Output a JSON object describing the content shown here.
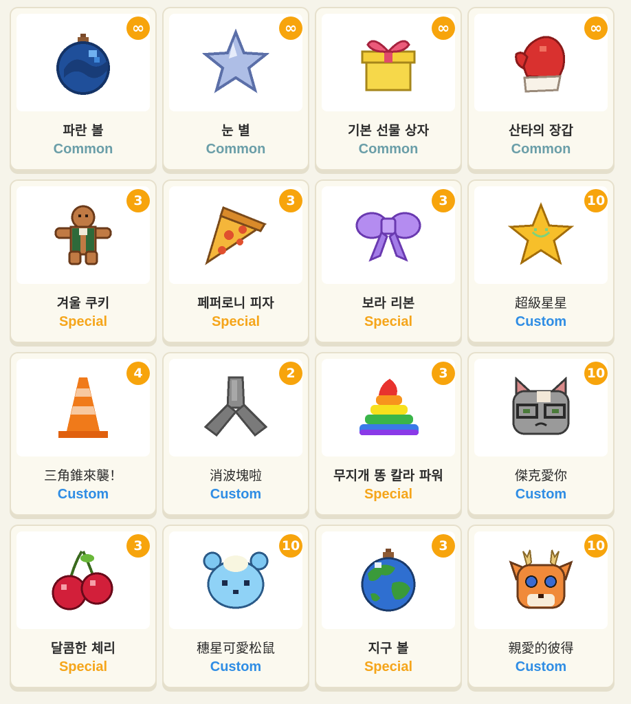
{
  "items": [
    {
      "name": "파란 볼",
      "rarity": "Common",
      "count": "∞",
      "icon": "blue-ornament-icon"
    },
    {
      "name": "눈 별",
      "rarity": "Common",
      "count": "∞",
      "icon": "snow-star-icon"
    },
    {
      "name": "기본 선물 상자",
      "rarity": "Common",
      "count": "∞",
      "icon": "gift-box-icon"
    },
    {
      "name": "산타의 장갑",
      "rarity": "Common",
      "count": "∞",
      "icon": "santa-mitten-icon"
    },
    {
      "name": "겨울 쿠키",
      "rarity": "Special",
      "count": "3",
      "icon": "gingerbread-cookie-icon"
    },
    {
      "name": "페퍼로니 피자",
      "rarity": "Special",
      "count": "3",
      "icon": "pizza-slice-icon"
    },
    {
      "name": "보라 리본",
      "rarity": "Special",
      "count": "3",
      "icon": "purple-ribbon-icon"
    },
    {
      "name": "超級星星",
      "rarity": "Custom",
      "count": "10",
      "icon": "super-star-icon"
    },
    {
      "name": "三角錐來襲！",
      "rarity": "Custom",
      "count": "4",
      "icon": "traffic-cone-icon"
    },
    {
      "name": "消波塊啦",
      "rarity": "Custom",
      "count": "2",
      "icon": "tetrapod-icon"
    },
    {
      "name": "무지개 똥 칼라 파워",
      "rarity": "Special",
      "count": "3",
      "icon": "rainbow-poop-icon"
    },
    {
      "name": "傑克愛你",
      "rarity": "Custom",
      "count": "10",
      "icon": "cat-face-icon"
    },
    {
      "name": "달콤한 체리",
      "rarity": "Special",
      "count": "3",
      "icon": "cherry-icon"
    },
    {
      "name": "穗星可愛松鼠",
      "rarity": "Custom",
      "count": "10",
      "icon": "blue-bear-icon"
    },
    {
      "name": "지구 볼",
      "rarity": "Special",
      "count": "3",
      "icon": "earth-ornament-icon"
    },
    {
      "name": "親愛的彼得",
      "rarity": "Custom",
      "count": "10",
      "icon": "deer-face-icon"
    }
  ],
  "colors": {
    "common": "#6a9ea8",
    "special": "#f5a51a",
    "custom": "#2f8de4",
    "badge": "#f7a40c",
    "background": "#f6f4ea"
  }
}
